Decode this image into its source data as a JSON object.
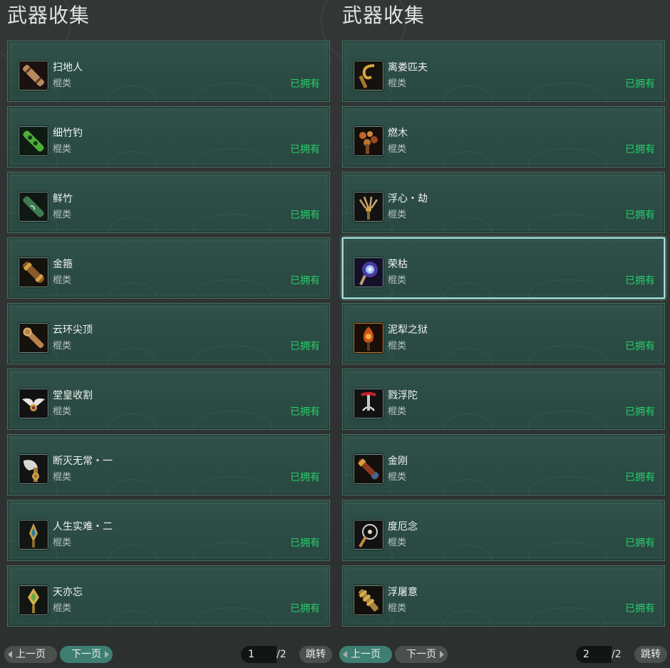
{
  "left_panel": {
    "title": "武器收集",
    "items": [
      {
        "name": "扫地人",
        "type": "棍类",
        "status": "已拥有",
        "icon": "wooden-staff-icon"
      },
      {
        "name": "细竹钓",
        "type": "棍类",
        "status": "已拥有",
        "icon": "jade-bamboo-staff-icon"
      },
      {
        "name": "鲜竹",
        "type": "棍类",
        "status": "已拥有",
        "icon": "green-bamboo-staff-icon"
      },
      {
        "name": "金箍",
        "type": "棍类",
        "status": "已拥有",
        "icon": "golden-staff-icon"
      },
      {
        "name": "云环尖顶",
        "type": "棍类",
        "status": "已拥有",
        "icon": "cloud-ring-staff-icon"
      },
      {
        "name": "堂皇收割",
        "type": "棍类",
        "status": "已拥有",
        "icon": "winged-staff-icon"
      },
      {
        "name": "断灭无常・一",
        "type": "棍类",
        "status": "已拥有",
        "icon": "axe-staff-icon"
      },
      {
        "name": "人生实难・二",
        "type": "棍类",
        "status": "已拥有",
        "icon": "trident-staff-icon"
      },
      {
        "name": "天亦忘",
        "type": "棍类",
        "status": "已拥有",
        "icon": "golden-trident-staff-icon"
      }
    ],
    "pager": {
      "prev": "上一页",
      "next": "下一页",
      "page": "1",
      "total": "/2",
      "jump": "跳转"
    }
  },
  "right_panel": {
    "title": "武器收集",
    "items": [
      {
        "name": "离娄匹夫",
        "type": "棍类",
        "status": "已拥有",
        "icon": "golden-hook-staff-icon"
      },
      {
        "name": "燃木",
        "type": "棍类",
        "status": "已拥有",
        "icon": "beaded-staff-icon"
      },
      {
        "name": "浮心・劫",
        "type": "棍类",
        "status": "已拥有",
        "icon": "claw-staff-icon"
      },
      {
        "name": "荣枯",
        "type": "棍类",
        "status": "已拥有",
        "icon": "orb-staff-icon"
      },
      {
        "name": "泥犁之狱",
        "type": "棍类",
        "status": "已拥有",
        "icon": "flame-staff-icon"
      },
      {
        "name": "戮浮陀",
        "type": "棍类",
        "status": "已拥有",
        "icon": "crimson-claw-staff-icon"
      },
      {
        "name": "金刚",
        "type": "棍类",
        "status": "已拥有",
        "icon": "vajra-staff-icon"
      },
      {
        "name": "度厄念",
        "type": "棍类",
        "status": "已拥有",
        "icon": "ring-staff-icon"
      },
      {
        "name": "浮屠意",
        "type": "棍类",
        "status": "已拥有",
        "icon": "pagoda-staff-icon"
      }
    ],
    "pager": {
      "prev": "上一页",
      "next": "下一页",
      "page": "2",
      "total": "/2",
      "jump": "跳转"
    }
  },
  "colors": {
    "card_bg": "#2b4c44",
    "owned_text": "#26d06a",
    "selected_border": "#bfeee8",
    "active_pill": "#3f7f73"
  }
}
